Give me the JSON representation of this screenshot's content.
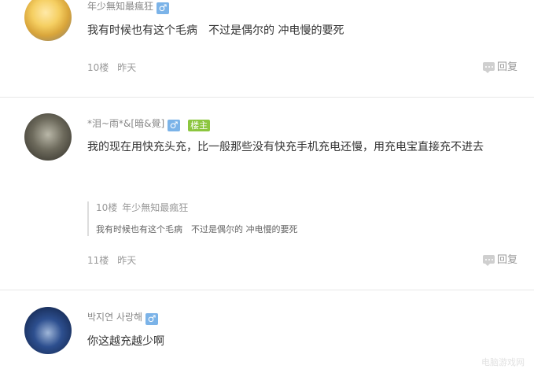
{
  "posts": [
    {
      "username": "年少無知最瘋狂",
      "gender_symbol": "♂",
      "content": "我有时候也有这个毛病　不过是偶尔的  冲电慢的要死",
      "floor": "10楼",
      "time": "昨天",
      "reply_label": "回复"
    },
    {
      "username": "*泪~雨*&[暗&覺]",
      "gender_symbol": "♂",
      "owner_badge": "楼主",
      "content": "我的现在用快充头充，比一般那些没有快充手机充电还慢，用充电宝直接充不进去",
      "quote": {
        "floor": "10楼",
        "username": "年少無知最瘋狂",
        "content": "我有时候也有这个毛病　不过是偶尔的  冲电慢的要死"
      },
      "floor": "11楼",
      "time": "昨天",
      "reply_label": "回复"
    },
    {
      "username": "박지연 사랑해",
      "gender_symbol": "♂",
      "content": "你这越充越少啊"
    }
  ],
  "watermark": "电脑游戏网",
  "colors": {
    "gender_badge": "#7bb3e8",
    "owner_badge": "#8cc63f",
    "divider": "#e8e8e8"
  }
}
